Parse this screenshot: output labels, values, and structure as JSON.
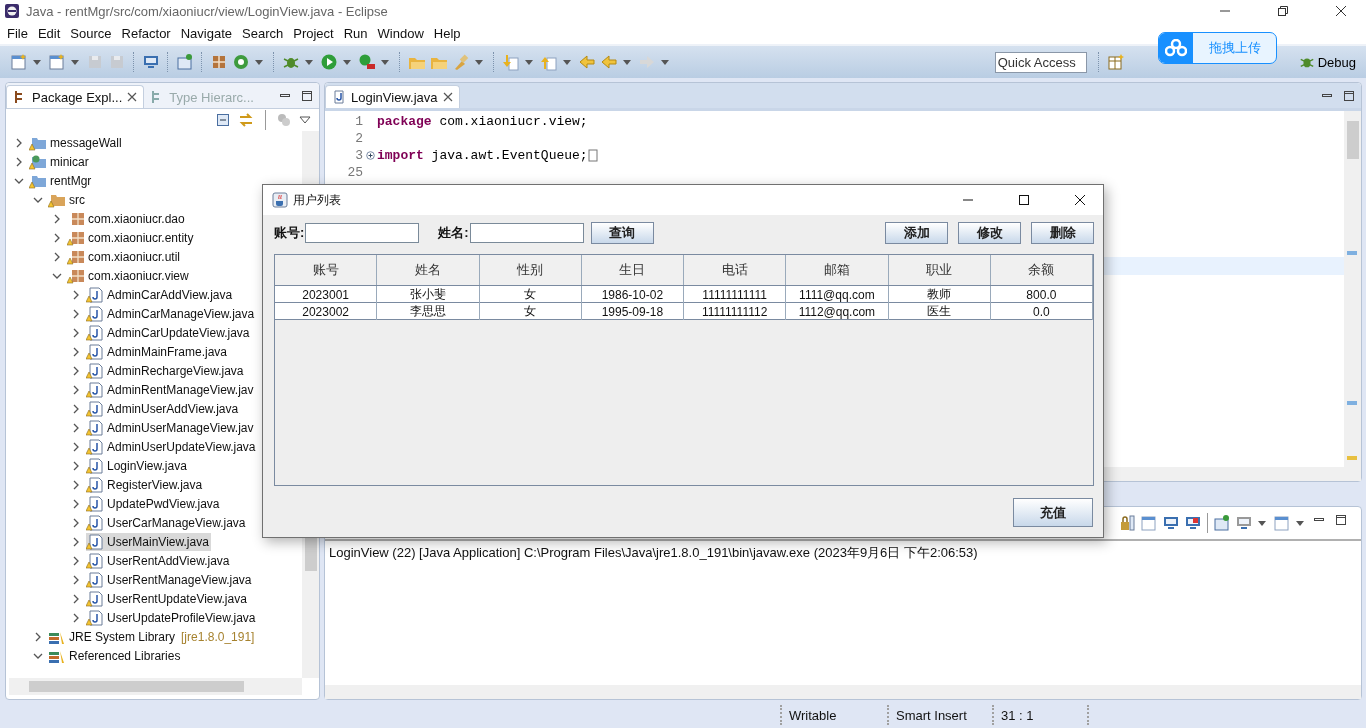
{
  "window": {
    "title": "Java - rentMgr/src/com/xiaoniucr/view/LoginView.java - Eclipse"
  },
  "menu": [
    "File",
    "Edit",
    "Source",
    "Refactor",
    "Navigate",
    "Search",
    "Project",
    "Run",
    "Window",
    "Help"
  ],
  "quick_access": {
    "placeholder": "Quick Access"
  },
  "perspective_button": "Debug",
  "explorer": {
    "tabs": [
      {
        "label": "Package Expl...",
        "selected": true
      },
      {
        "label": "Type Hierarc...",
        "selected": false
      }
    ],
    "tree": [
      {
        "label": "messageWall",
        "kind": "project",
        "expanded": false,
        "selected": false
      },
      {
        "label": "minicar",
        "kind": "webproject",
        "expanded": false,
        "selected": false
      },
      {
        "label": "rentMgr",
        "kind": "project",
        "expanded": true,
        "selected": false,
        "children": [
          {
            "label": "src",
            "kind": "source",
            "expanded": true,
            "selected": false,
            "children": [
              {
                "label": "com.xiaoniucr.dao",
                "kind": "package",
                "expanded": false,
                "selected": false
              },
              {
                "label": "com.xiaoniucr.entity",
                "kind": "package",
                "expanded": false,
                "selected": false
              },
              {
                "label": "com.xiaoniucr.util",
                "kind": "package",
                "expanded": false,
                "selected": false
              },
              {
                "label": "com.xiaoniucr.view",
                "kind": "package",
                "expanded": true,
                "selected": false,
                "children": [
                  {
                    "label": "AdminCarAddView.java",
                    "kind": "file",
                    "expanded": false,
                    "selected": false
                  },
                  {
                    "label": "AdminCarManageView.java",
                    "kind": "file",
                    "expanded": false,
                    "selected": false
                  },
                  {
                    "label": "AdminCarUpdateView.java",
                    "kind": "file",
                    "expanded": false,
                    "selected": false
                  },
                  {
                    "label": "AdminMainFrame.java",
                    "kind": "file",
                    "expanded": false,
                    "selected": false
                  },
                  {
                    "label": "AdminRechargeView.java",
                    "kind": "file",
                    "expanded": false,
                    "selected": false
                  },
                  {
                    "label": "AdminRentManageView.jav",
                    "kind": "file",
                    "expanded": false,
                    "selected": false
                  },
                  {
                    "label": "AdminUserAddView.java",
                    "kind": "file",
                    "expanded": false,
                    "selected": false
                  },
                  {
                    "label": "AdminUserManageView.jav",
                    "kind": "file",
                    "expanded": false,
                    "selected": false
                  },
                  {
                    "label": "AdminUserUpdateView.java",
                    "kind": "file",
                    "expanded": false,
                    "selected": false
                  },
                  {
                    "label": "LoginView.java",
                    "kind": "file",
                    "expanded": false,
                    "selected": false
                  },
                  {
                    "label": "RegisterView.java",
                    "kind": "file",
                    "expanded": false,
                    "selected": false
                  },
                  {
                    "label": "UpdatePwdView.java",
                    "kind": "file",
                    "expanded": false,
                    "selected": false
                  },
                  {
                    "label": "UserCarManageView.java",
                    "kind": "file",
                    "expanded": false,
                    "selected": false
                  },
                  {
                    "label": "UserMainView.java",
                    "kind": "file",
                    "expanded": false,
                    "selected": true
                  },
                  {
                    "label": "UserRentAddView.java",
                    "kind": "file",
                    "expanded": false,
                    "selected": false
                  },
                  {
                    "label": "UserRentManageView.java",
                    "kind": "file",
                    "expanded": false,
                    "selected": false
                  },
                  {
                    "label": "UserRentUpdateView.java",
                    "kind": "file",
                    "expanded": false,
                    "selected": false
                  },
                  {
                    "label": "UserUpdateProfileView.java",
                    "kind": "file",
                    "expanded": false,
                    "selected": false
                  }
                ]
              }
            ]
          },
          {
            "label": "JRE System Library",
            "decoration": "[jre1.8.0_191]",
            "kind": "library",
            "expanded": false,
            "selected": false
          },
          {
            "label": "Referenced Libraries",
            "kind": "library",
            "expanded": true,
            "selected": false
          }
        ]
      }
    ]
  },
  "editor": {
    "tabs": [
      {
        "label": "LoginView.java",
        "selected": true
      }
    ],
    "lines": [
      {
        "number": "1",
        "keyword": "package",
        "text": " com.xiaoniucr.view;",
        "folded": false
      },
      {
        "number": "2",
        "folded": false
      },
      {
        "number": "3",
        "keyword": "import",
        "text": " java.awt.EventQueue;",
        "folded": true
      },
      {
        "number": "25",
        "folded": false
      }
    ]
  },
  "console": {
    "text": "LoginView (22) [Java Application] C:\\Program Files\\Java\\jre1.8.0_191\\bin\\javaw.exe (2023年9月6日 下午2:06:53)"
  },
  "status_bar": [
    "Writable",
    "Smart Insert",
    "31 : 1"
  ],
  "upload_widget": {
    "label": "拖拽上传"
  },
  "dialog": {
    "title": "用户列表",
    "fields": [
      {
        "label": "账号:"
      },
      {
        "label": "姓名:"
      }
    ],
    "search_button": "查询",
    "action_buttons": [
      "添加",
      "修改",
      "删除"
    ],
    "table": {
      "columns": [
        "账号",
        "姓名",
        "性别",
        "生日",
        "电话",
        "邮箱",
        "职业",
        "余额"
      ],
      "rows": [
        [
          "2023001",
          "张小斐",
          "女",
          "1986-10-02",
          "11111111111",
          "1111@qq.com",
          "教师",
          "800.0"
        ],
        [
          "2023002",
          "李思思",
          "女",
          "1995-09-18",
          "11111111112",
          "1112@qq.com",
          "医生",
          "0.0"
        ]
      ]
    },
    "recharge_button": "充值"
  }
}
